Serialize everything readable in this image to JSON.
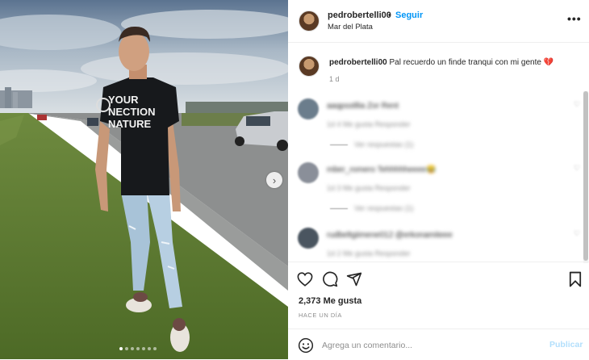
{
  "post": {
    "username": "pedrobertelli00",
    "follow_label": "Seguir",
    "separator": "•",
    "location": "Mar del Plata",
    "more_label": "•••"
  },
  "caption": {
    "username": "pedrobertelli00",
    "text": "Pal recuerdo un finde tranqui con mi gente 💔",
    "time": "1 d"
  },
  "comments": [
    {
      "text": "aaqpsstllia Zor Rent",
      "meta": "1d   4 Me gusta   Responder",
      "replies": "Ver respuestas (1)",
      "avatar_color": "#6b7d8c"
    },
    {
      "text": "mber_romero Tehhhhheeee😂",
      "meta": "1d   3 Me gusta   Responder",
      "replies": "Ver respuestas (1)",
      "avatar_color": "#8a8f99"
    },
    {
      "text": "rudbeltgiimene012 @erkonamiteee",
      "meta": "1d   2 Me gusta   Responder",
      "replies": "",
      "avatar_color": "#4a5560"
    }
  ],
  "actions": {
    "likes": "2,373 Me gusta",
    "time_ago": "HACE UN DÍA"
  },
  "add_comment": {
    "placeholder": "Agrega un comentario...",
    "publish_label": "Publicar"
  },
  "photo": {
    "shirt_text_line1": "YOUR",
    "shirt_text_line2": "NECTION",
    "shirt_text_line3": "NATURE",
    "next_icon": "›",
    "carousel_slides": 7,
    "carousel_active": 1
  }
}
